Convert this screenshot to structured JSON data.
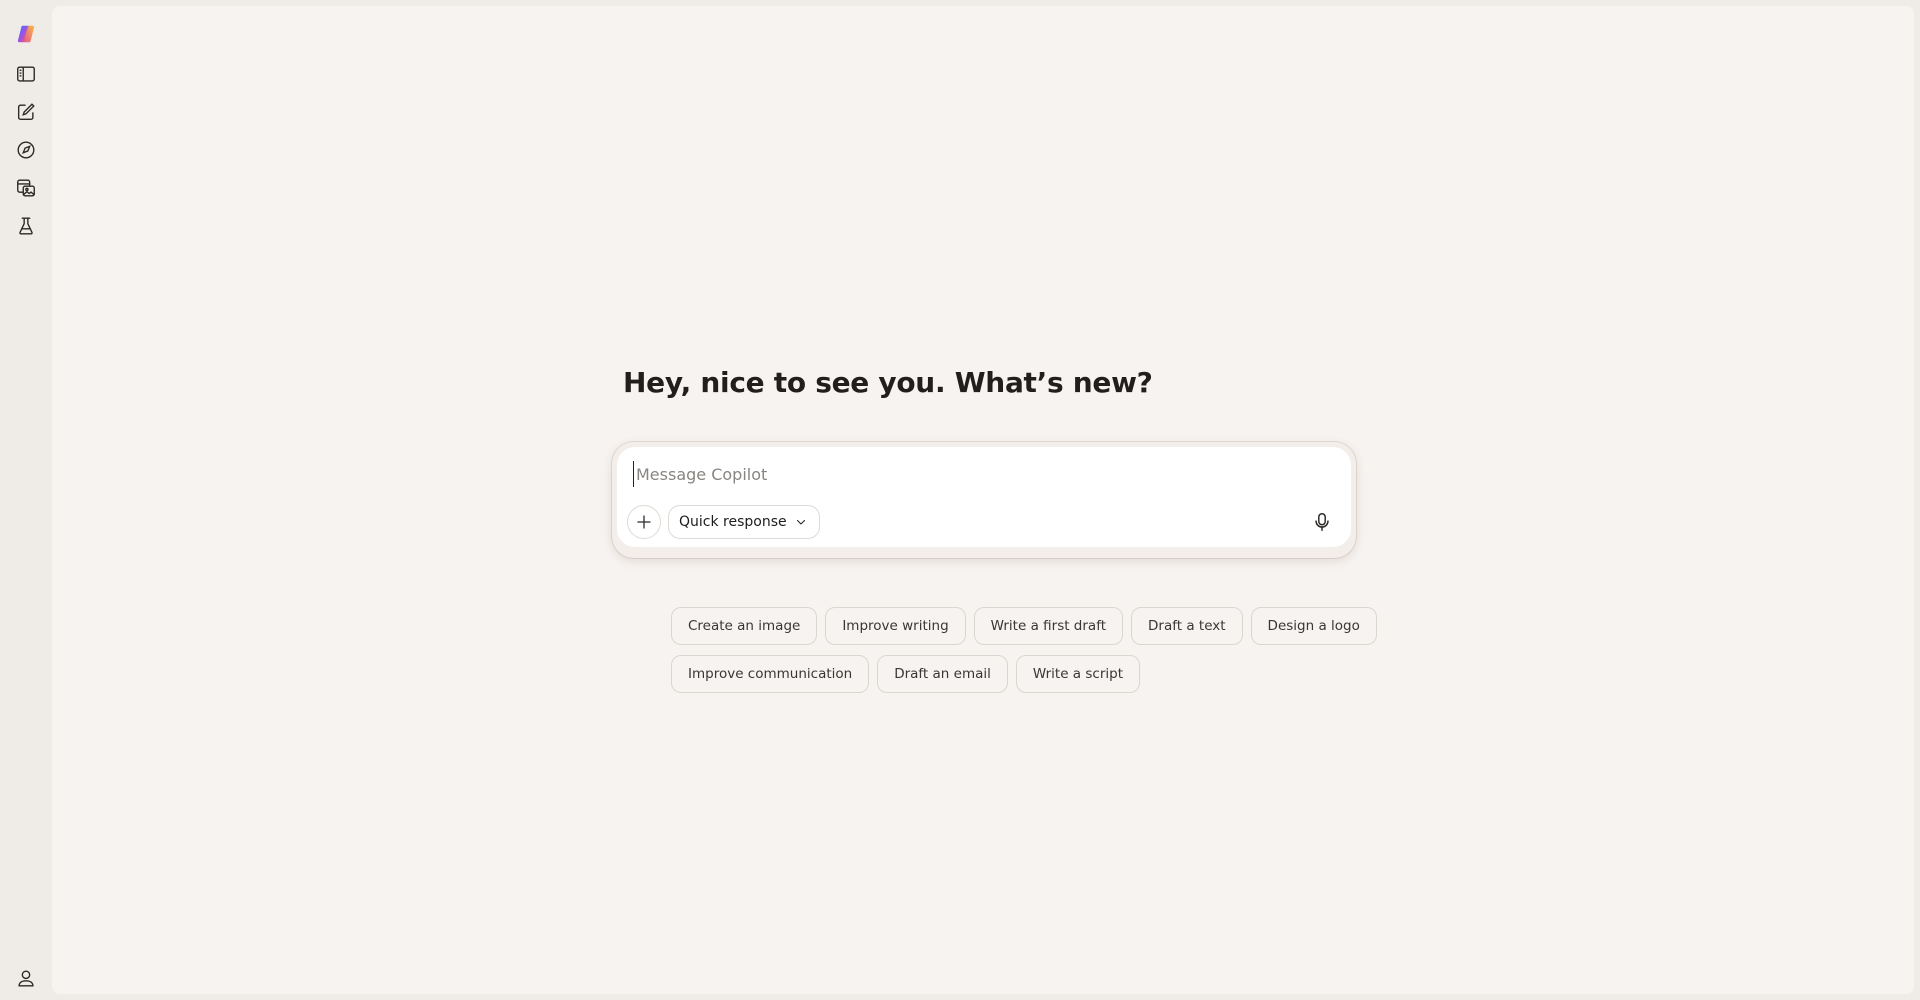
{
  "sidebar": {
    "items": [
      {
        "name": "copilot-logo",
        "icon": "copilot-logo-icon"
      },
      {
        "name": "toggle-sidebar",
        "icon": "sidebar-icon"
      },
      {
        "name": "new-chat",
        "icon": "compose-icon"
      },
      {
        "name": "discover",
        "icon": "compass-icon"
      },
      {
        "name": "imagine",
        "icon": "image-gallery-icon"
      },
      {
        "name": "labs",
        "icon": "flask-icon"
      }
    ],
    "profile_icon": "user-icon"
  },
  "main": {
    "greeting": "Hey, nice to see you. What’s new?"
  },
  "composer": {
    "placeholder": "Message Copilot",
    "value": "",
    "mode_label": "Quick response",
    "add_icon": "plus-icon",
    "mode_icon": "chevron-down-icon",
    "voice_icon": "microphone-icon"
  },
  "suggestions": {
    "row1": [
      "Create an image",
      "Improve writing",
      "Write a first draft",
      "Draft a text",
      "Design a logo"
    ],
    "row2": [
      "Improve communication",
      "Draft an email",
      "Write a script"
    ]
  },
  "colors": {
    "background": "#efebe7",
    "canvas": "#f6f3f0",
    "composer": "#ffffff",
    "text": "#1f1d1b"
  }
}
